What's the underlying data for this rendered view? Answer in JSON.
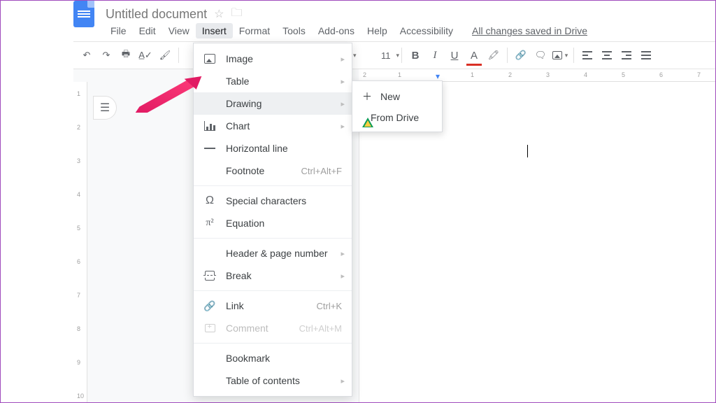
{
  "doc": {
    "title": "Untitled document"
  },
  "menus": {
    "file": "File",
    "edit": "Edit",
    "view": "View",
    "insert": "Insert",
    "format": "Format",
    "tools": "Tools",
    "addons": "Add-ons",
    "help": "Help",
    "accessibility": "Accessibility"
  },
  "save_status": "All changes saved in Drive",
  "toolbar": {
    "font_size": "11"
  },
  "insert_menu": {
    "image": "Image",
    "table": "Table",
    "drawing": "Drawing",
    "chart": "Chart",
    "hr": "Horizontal line",
    "footnote": "Footnote",
    "footnote_sc": "Ctrl+Alt+F",
    "special": "Special characters",
    "equation": "Equation",
    "header": "Header & page number",
    "break": "Break",
    "link": "Link",
    "link_sc": "Ctrl+K",
    "comment": "Comment",
    "comment_sc": "Ctrl+Alt+M",
    "bookmark": "Bookmark",
    "toc": "Table of contents"
  },
  "drawing_submenu": {
    "new": "New",
    "from_drive": "From Drive"
  },
  "hruler": {
    "n2": "2",
    "n1": "1",
    "n3": "3",
    "n4": "4",
    "n5": "5",
    "n6": "6",
    "n7": "7"
  },
  "vruler": {
    "n1": "1",
    "n2": "2",
    "n3": "3",
    "n4": "4",
    "n5": "5",
    "n6": "6",
    "n7": "7",
    "n8": "8",
    "n9": "9",
    "n10": "10"
  }
}
